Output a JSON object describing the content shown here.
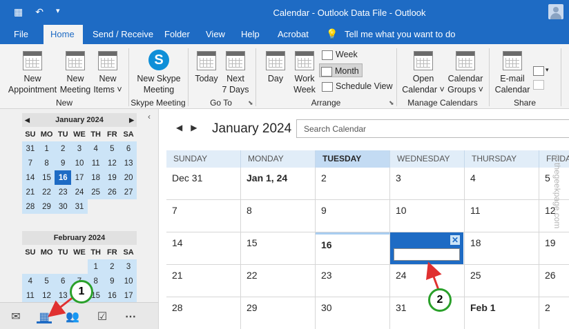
{
  "window": {
    "title": "Calendar - Outlook Data File  -  Outlook"
  },
  "menu": {
    "tabs": [
      "File",
      "Home",
      "Send / Receive",
      "Folder",
      "View",
      "Help",
      "Acrobat"
    ],
    "active": "Home",
    "tell_me": "Tell me what you want to do"
  },
  "ribbon": {
    "new_appointment": [
      "New",
      "Appointment"
    ],
    "new_meeting": [
      "New",
      "Meeting"
    ],
    "new_items": [
      "New",
      "Items ˅"
    ],
    "group_new": "New",
    "new_skype_meeting": [
      "New Skype",
      "Meeting"
    ],
    "group_skype": "Skype Meeting",
    "today": "Today",
    "next_7_days": [
      "Next",
      "7 Days"
    ],
    "group_goto": "Go To",
    "day": "Day",
    "work_week": [
      "Work",
      "Week"
    ],
    "week": "Week",
    "month": "Month",
    "schedule_view": "Schedule View",
    "group_arrange": "Arrange",
    "open_calendar": [
      "Open",
      "Calendar ˅"
    ],
    "calendar_groups": [
      "Calendar",
      "Groups ˅"
    ],
    "group_manage": "Manage Calendars",
    "email_calendar": [
      "E-mail",
      "Calendar"
    ],
    "group_share": "Share"
  },
  "mini_calendars": [
    {
      "title": "January 2024",
      "dow": [
        "SU",
        "MO",
        "TU",
        "WE",
        "TH",
        "FR",
        "SA"
      ],
      "weeks": [
        [
          "31",
          "1",
          "2",
          "3",
          "4",
          "5",
          "6"
        ],
        [
          "7",
          "8",
          "9",
          "10",
          "11",
          "12",
          "13"
        ],
        [
          "14",
          "15",
          "16",
          "17",
          "18",
          "19",
          "20"
        ],
        [
          "21",
          "22",
          "23",
          "24",
          "25",
          "26",
          "27"
        ],
        [
          "28",
          "29",
          "30",
          "31",
          "",
          "",
          ""
        ]
      ],
      "today": "16"
    },
    {
      "title": "February 2024",
      "dow": [
        "SU",
        "MO",
        "TU",
        "WE",
        "TH",
        "FR",
        "SA"
      ],
      "weeks": [
        [
          "",
          "",
          "",
          "",
          "1",
          "2",
          "3"
        ],
        [
          "4",
          "5",
          "6",
          "7",
          "8",
          "9",
          "10"
        ],
        [
          "11",
          "12",
          "13",
          "14",
          "15",
          "16",
          "17"
        ]
      ]
    }
  ],
  "calendar": {
    "month_title": "January 2024",
    "search_placeholder": "Search Calendar",
    "day_headers": [
      "SUNDAY",
      "MONDAY",
      "TUESDAY",
      "WEDNESDAY",
      "THURSDAY",
      "FRIDA"
    ],
    "today_column": 2,
    "weeks": [
      [
        "Dec 31",
        "Jan 1, 24",
        "2",
        "3",
        "4",
        "5"
      ],
      [
        "7",
        "8",
        "9",
        "10",
        "11",
        "12"
      ],
      [
        "14",
        "15",
        "16",
        "",
        "18",
        "19"
      ],
      [
        "21",
        "22",
        "23",
        "24",
        "25",
        "26"
      ],
      [
        "28",
        "29",
        "30",
        "31",
        "Feb 1",
        "2"
      ]
    ],
    "bold_dates": [
      "Jan 1, 24",
      "16",
      "Feb 1"
    ]
  },
  "annotations": {
    "badge1": "1",
    "badge2": "2",
    "arrow_color": "#e03030",
    "badge_border": "#2aa02a"
  },
  "watermark": "©thegeekpage.com",
  "colors": {
    "accent": "#1e6bc4",
    "highlight": "#cce4f7"
  }
}
